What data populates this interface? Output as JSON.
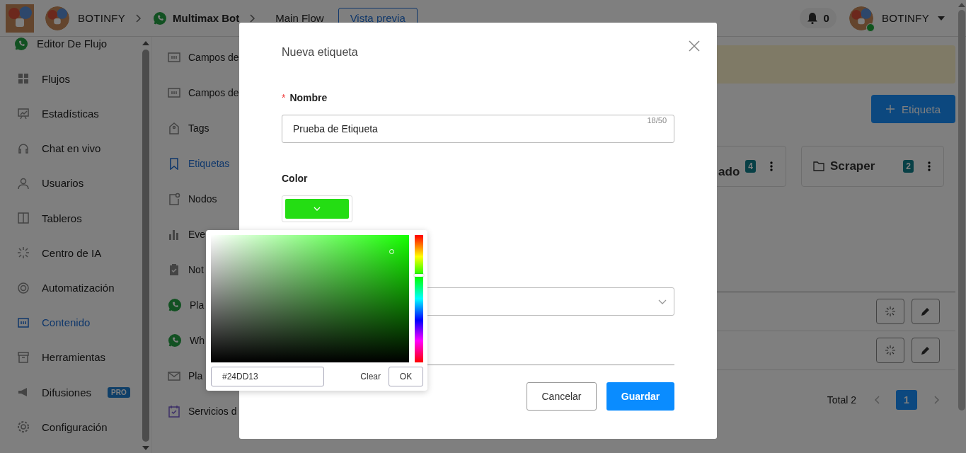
{
  "topbar": {
    "account": "BOTINFY",
    "bot": "Multimax Bot",
    "flow": "Main Flow",
    "preview_button": "Vista previa",
    "notifications": "0",
    "user": {
      "name": "BOTINFY",
      "online": true
    }
  },
  "sidebar": {
    "header": "Editor De Flujo",
    "items": [
      {
        "label": "Flujos",
        "selected": false
      },
      {
        "label": "Estadísticas",
        "selected": false
      },
      {
        "label": "Chat en vivo",
        "selected": false
      },
      {
        "label": "Usuarios",
        "selected": false
      },
      {
        "label": "Tableros",
        "selected": false
      },
      {
        "label": "Centro de IA",
        "selected": false
      },
      {
        "label": "Automatización",
        "selected": false
      },
      {
        "label": "Contenido",
        "selected": true
      },
      {
        "label": "Herramientas",
        "selected": false
      },
      {
        "label": "Difusiones",
        "selected": false,
        "badge": "PRO"
      },
      {
        "label": "Configuración",
        "selected": false
      }
    ]
  },
  "subnav": {
    "items": [
      {
        "label": "Campos de",
        "selected": false
      },
      {
        "label": "Campos de",
        "selected": false
      },
      {
        "label": "Tags",
        "selected": false
      },
      {
        "label": "Etiquetas",
        "selected": true
      },
      {
        "label": "Nodos",
        "selected": false
      },
      {
        "label": "Eve",
        "selected": false
      },
      {
        "label": "Not",
        "selected": false
      },
      {
        "label": "Pla",
        "selected": false
      },
      {
        "label": "Wh",
        "selected": false
      },
      {
        "label": "Pla",
        "selected": false
      },
      {
        "label": "Servicios d",
        "selected": false
      }
    ]
  },
  "content": {
    "add_button": "Etiqueta",
    "folders": [
      {
        "name": "ado",
        "count": "4"
      },
      {
        "name": "Scraper",
        "count": "2"
      }
    ],
    "rows": [
      {
        "actions": [
          {
            "kind": "sparkle"
          },
          {
            "kind": "edit"
          }
        ]
      },
      {
        "actions": [
          {
            "kind": "sparkle"
          },
          {
            "kind": "edit"
          }
        ]
      }
    ],
    "pagination": {
      "total": "Total 2",
      "pages": [
        {
          "label": "1",
          "selected": true
        }
      ]
    }
  },
  "modal": {
    "title": "Nueva etiqueta",
    "name_field": {
      "required_mark": "*",
      "label": "Nombre",
      "value": "Prueba de Etiqueta",
      "counter": "18/50"
    },
    "color_field": {
      "label": "Color",
      "color": "#24dd13"
    },
    "picker": {
      "hex": "#24DD13",
      "clear": "Clear",
      "ok": "OK"
    },
    "buttons": {
      "cancel": "Cancelar",
      "save": "Guardar"
    }
  }
}
